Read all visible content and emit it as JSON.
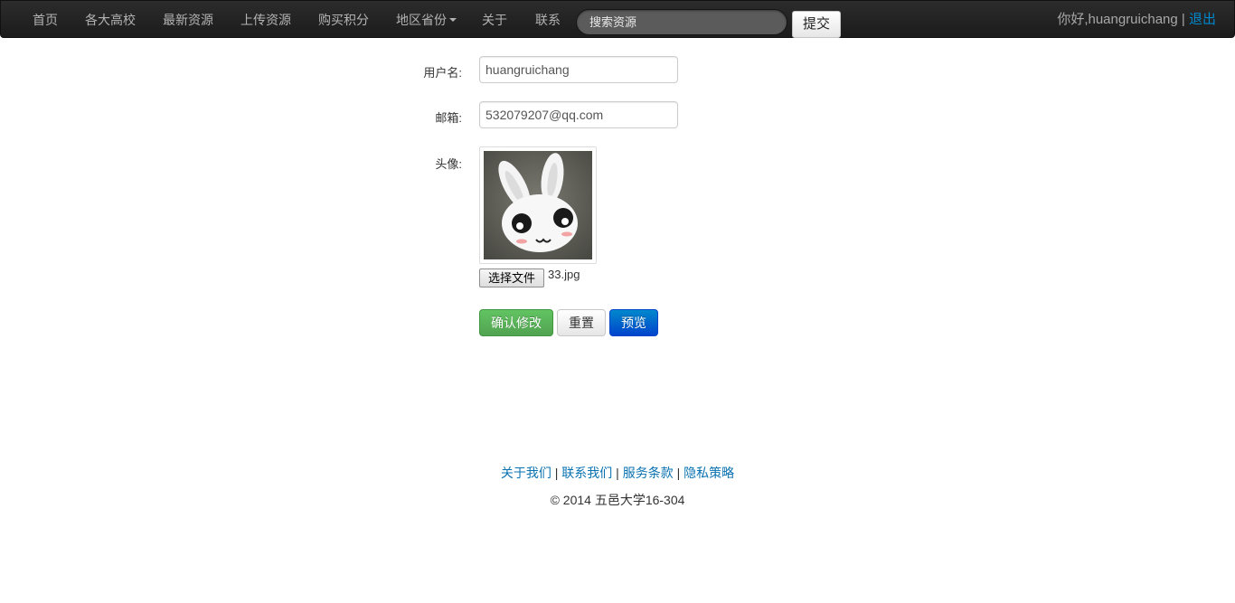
{
  "navbar": {
    "items": [
      {
        "label": "首页"
      },
      {
        "label": "各大高校"
      },
      {
        "label": "最新资源"
      },
      {
        "label": "上传资源"
      },
      {
        "label": "购买积分"
      },
      {
        "label": "地区省份"
      },
      {
        "label": "关于"
      },
      {
        "label": "联系"
      }
    ],
    "search_placeholder": "搜索资源",
    "submit_label": "提交",
    "greeting": "你好,huangruichang",
    "separator": "|",
    "logout_label": "退出"
  },
  "form": {
    "username_label": "用户名:",
    "username_value": "huangruichang",
    "email_label": "邮箱:",
    "email_value": "532079207@qq.com",
    "avatar_label": "头像:",
    "file_button_label": "选择文件",
    "file_name": "33.jpg",
    "confirm_label": "确认修改",
    "reset_label": "重置",
    "preview_label": "预览"
  },
  "footer": {
    "links": [
      {
        "label": "关于我们"
      },
      {
        "label": "联系我们"
      },
      {
        "label": "服务条款"
      },
      {
        "label": "隐私策略"
      }
    ],
    "separator": "|",
    "copyright": "© 2014 五邑大学16-304"
  },
  "colors": {
    "navbar_bg": "#1b1b1b",
    "link": "#0088cc",
    "success": "#5bb75b",
    "primary": "#0055cc"
  },
  "icons": {
    "dropdown": "caret-down-icon",
    "avatar": "bunny-avatar-image"
  }
}
